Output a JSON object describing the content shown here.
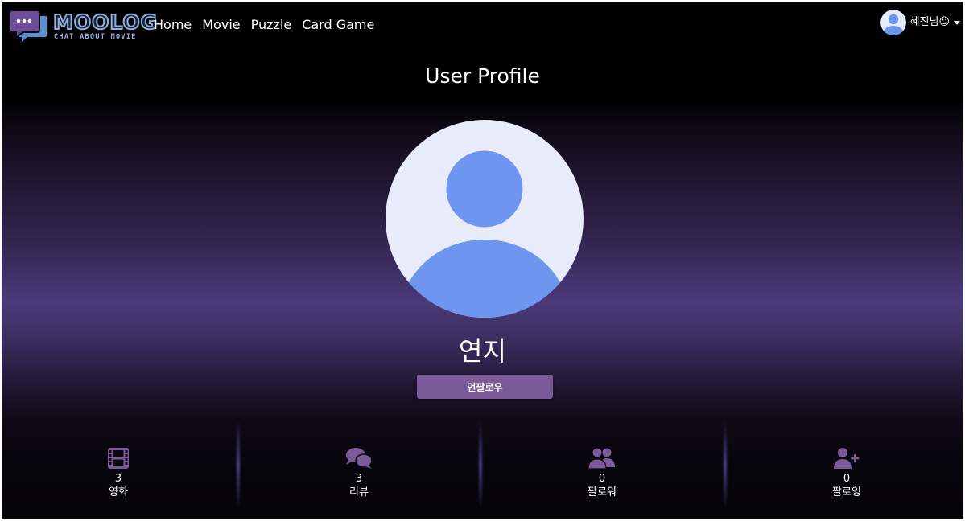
{
  "navbar": {
    "logo_text": "MOOLOG",
    "logo_subtitle": "CHAT ABOUT MOVIE",
    "links": [
      "Home",
      "Movie",
      "Puzzle",
      "Card Game"
    ],
    "user_name": "혜진님☺"
  },
  "profile": {
    "title": "User Profile",
    "name": "연지",
    "unfollow_label": "언팔로우"
  },
  "stats": [
    {
      "icon": "film-icon",
      "value": "3",
      "label": "영화"
    },
    {
      "icon": "comments-icon",
      "value": "3",
      "label": "리뷰"
    },
    {
      "icon": "users-icon",
      "value": "0",
      "label": "팔로워"
    },
    {
      "icon": "user-plus-icon",
      "value": "0",
      "label": "팔로잉"
    }
  ],
  "colors": {
    "accent": "#7b5a98",
    "icon": "#7b5a98",
    "avatar_bg": "#e8ebfa",
    "avatar_fg": "#6e96f0",
    "logo_outline": "#8fb0df"
  }
}
